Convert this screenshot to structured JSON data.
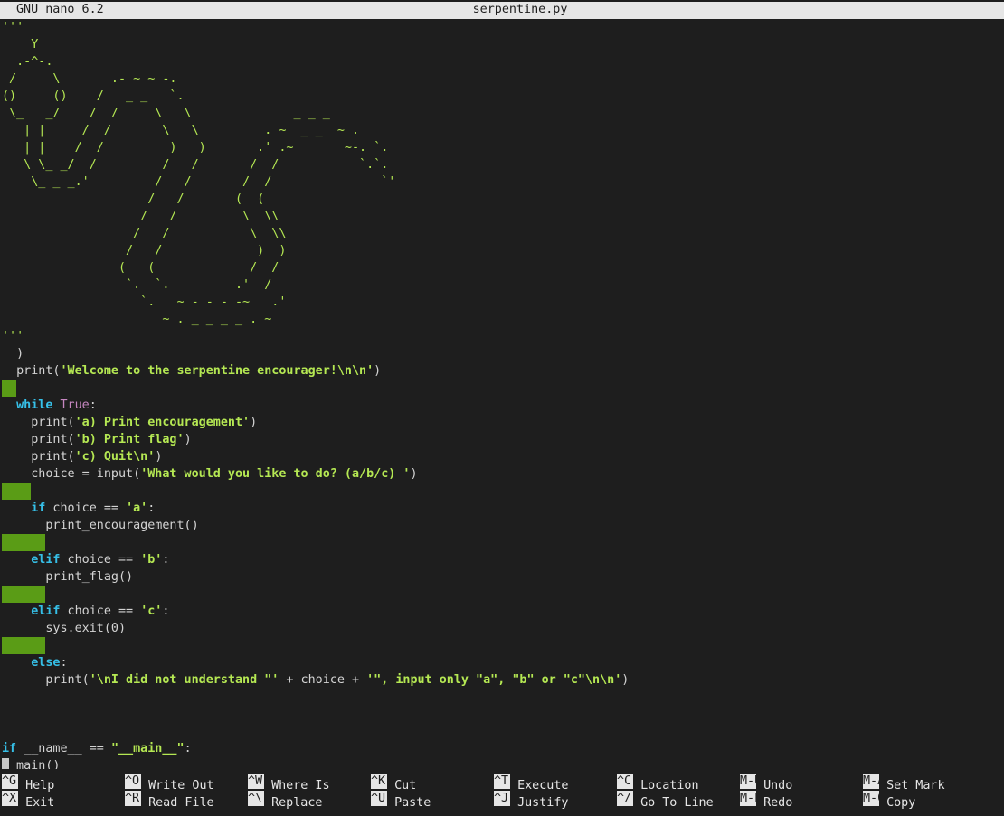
{
  "titlebar": {
    "app": "GNU nano 6.2",
    "filename": "serpentine.py"
  },
  "ascii_art": [
    "'''",
    "    Y",
    "  .-^-.",
    " /     \\       .- ~ ~ -.",
    "()     ()    /   _ _   `.",
    " \\_   _/    /  /     \\   \\              _ _ _",
    "   | |     /  /       \\   \\         . ~  _ _  ~ .",
    "   | |    /  /         )   )       .' .~       ~-. `.",
    "   \\ \\_ _/  /         /   /       /  /           `.`.",
    "    \\_ _ _.'         /   /       /  /               `'",
    "                    /   /       (  (",
    "                   /   /         \\  \\\\",
    "                  /   /           \\  \\\\",
    "                 /   /             )  )",
    "                (   (             /  /",
    "                 `.  `.         .'  /",
    "                   `.   ~ - - - -~   .'",
    "                      ~ . _ _ _ _ . ~",
    "'''"
  ],
  "code": {
    "close_paren": "  )",
    "print_welcome": {
      "fn": "  print(",
      "str": "'Welcome to the serpentine encourager!\\n\\n'",
      "close": ")"
    },
    "while_kw": "while",
    "while_true": "True",
    "colon": ":",
    "menu_a": {
      "fn": "    print(",
      "str": "'a) Print encouragement'",
      "close": ")"
    },
    "menu_b": {
      "fn": "    print(",
      "str": "'b) Print flag'",
      "close": ")"
    },
    "menu_c": {
      "fn": "    print(",
      "str": "'c) Quit\\n'",
      "close": ")"
    },
    "choice_line": {
      "pre": "    choice = input(",
      "str": "'What would you like to do? (a/b/c) '",
      "close": ")"
    },
    "if_kw": "if",
    "elif_kw": "elif",
    "else_kw": "else",
    "cond_a": {
      "pre": " choice == ",
      "str": "'a'",
      "post": ":"
    },
    "call_a": "      print_encouragement()",
    "cond_b": {
      "pre": " choice == ",
      "str": "'b'",
      "post": ":"
    },
    "call_b": "      print_flag()",
    "cond_c": {
      "pre": " choice == ",
      "str": "'c'",
      "post": ":"
    },
    "call_c": "      sys.exit(0)",
    "else_colon": ":",
    "else_print": {
      "pre": "      print(",
      "s1": "'\\nI did not understand \"'",
      "mid": " + choice + ",
      "s2": "'\", input only \"a\", \"b\" or \"c\"\\n\\n'",
      "close": ")"
    },
    "main_if": {
      "kw": "if",
      "pre": " __name__ == ",
      "str": "\"__main__\"",
      "post": ":"
    },
    "main_call": " main()"
  },
  "shortcuts": [
    {
      "key": "^G",
      "label": "Help"
    },
    {
      "key": "^X",
      "label": "Exit"
    },
    {
      "key": "^O",
      "label": "Write Out"
    },
    {
      "key": "^R",
      "label": "Read File"
    },
    {
      "key": "^W",
      "label": "Where Is"
    },
    {
      "key": "^\\",
      "label": "Replace"
    },
    {
      "key": "^K",
      "label": "Cut"
    },
    {
      "key": "^U",
      "label": "Paste"
    },
    {
      "key": "^T",
      "label": "Execute"
    },
    {
      "key": "^J",
      "label": "Justify"
    },
    {
      "key": "^C",
      "label": "Location"
    },
    {
      "key": "^/",
      "label": "Go To Line"
    },
    {
      "key": "M-U",
      "label": "Undo"
    },
    {
      "key": "M-E",
      "label": "Redo"
    },
    {
      "key": "M-A",
      "label": "Set Mark"
    },
    {
      "key": "M-6",
      "label": "Copy"
    }
  ],
  "colors": {
    "background": "#1e1e1e",
    "titlebar": "#e6e6e6",
    "keyword": "#36c0e8",
    "string": "#b5e853",
    "constant": "#c586c0",
    "whitespace_marker": "#5a9c16"
  }
}
